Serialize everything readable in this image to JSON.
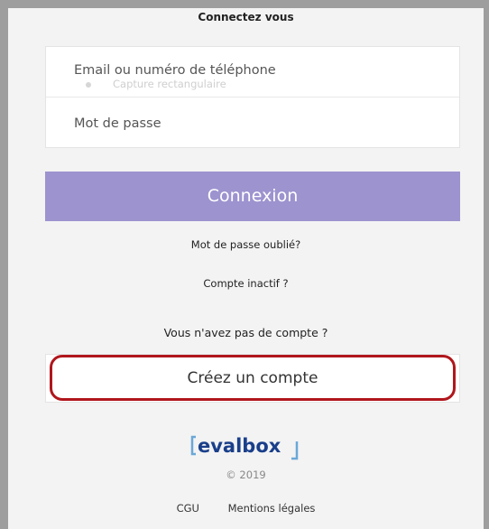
{
  "header": {
    "title": "Connectez vous"
  },
  "form": {
    "email_placeholder": "Email ou numéro de téléphone",
    "password_placeholder": "Mot de passe",
    "ghost_overlay_text": "Capture rectangulaire",
    "submit_label": "Connexion"
  },
  "links": {
    "forgot_password": "Mot de passe oublié?",
    "inactive_account": "Compte inactif ?",
    "no_account_prompt": "Vous n'avez pas de compte ?",
    "create_account": "Créez un compte"
  },
  "branding": {
    "logo_text": "evalbox",
    "copyright": "© 2019",
    "brand_color": "#1a3f8a",
    "accent_color": "#9c93cf"
  },
  "footer": {
    "cgu": "CGU",
    "legal": "Mentions légales"
  },
  "highlight_color": "#b0161c"
}
